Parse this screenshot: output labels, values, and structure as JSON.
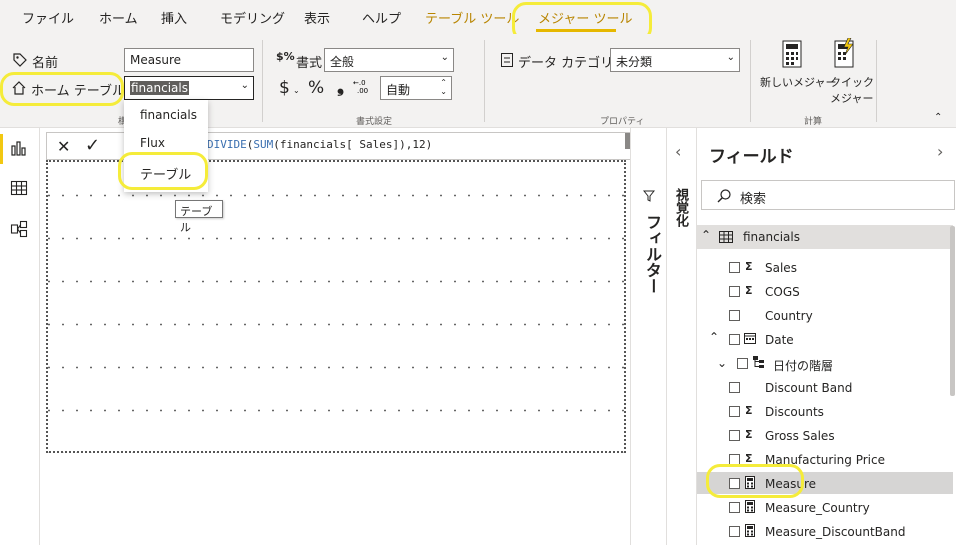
{
  "menu": {
    "tabs": [
      {
        "label": "ファイル"
      },
      {
        "label": "ホーム"
      },
      {
        "label": "挿入"
      },
      {
        "label": "モデリング"
      },
      {
        "label": "表示"
      },
      {
        "label": "ヘルプ"
      },
      {
        "label": "テーブル ツール"
      },
      {
        "label": "メジャー ツール"
      }
    ],
    "active_tab": "メジャー ツール"
  },
  "ribbon": {
    "structure": {
      "name_label": "名前",
      "name_value": "Measure",
      "home_table_label": "ホーム テーブル",
      "home_table_value": "financials",
      "group_title": "構"
    },
    "format": {
      "format_label": "書式",
      "format_value": "全般",
      "currency_symbol": "$",
      "percent_symbol": "%",
      "comma_symbol": "❟",
      "decimal_value": "自動",
      "group_title": "書式設定"
    },
    "properties": {
      "data_category_label": "データ カテゴリ",
      "data_category_value": "未分類",
      "group_title": "プロパティ"
    },
    "calculations": {
      "new_measure_label": "新しいメジャー",
      "quick_measure_label_1": "クイック",
      "quick_measure_label_2": "メジャー",
      "group_title": "計算"
    }
  },
  "dropdown": {
    "items": [
      "financials",
      "Flux",
      "テーブル"
    ],
    "tooltip": "テーブル"
  },
  "formula": {
    "fn1": "DIVIDE",
    "open1": "(",
    "fn2": "SUM",
    "rest": "(financials[ Sales]),12)"
  },
  "filters": {
    "label": "フィルター"
  },
  "visualizations": {
    "label": "視覚化"
  },
  "fields": {
    "title": "フィールド",
    "search_placeholder": "検索",
    "table_name": "financials",
    "items": [
      {
        "name": "Sales",
        "icon": "sigma"
      },
      {
        "name": "COGS",
        "icon": "sigma"
      },
      {
        "name": "Country",
        "icon": "none"
      },
      {
        "name": "Date",
        "icon": "calendar"
      },
      {
        "name": "日付の階層",
        "icon": "hierarchy"
      },
      {
        "name": "Discount Band",
        "icon": "none"
      },
      {
        "name": "Discounts",
        "icon": "sigma"
      },
      {
        "name": "Gross Sales",
        "icon": "sigma"
      },
      {
        "name": "Manufacturing Price",
        "icon": "sigma"
      },
      {
        "name": "Measure",
        "icon": "calculator"
      },
      {
        "name": "Measure_Country",
        "icon": "calculator"
      },
      {
        "name": "Measure_DiscountBand",
        "icon": "calculator"
      }
    ]
  },
  "colors": {
    "active_tab": "#b88500",
    "highlight": "#f5ec3a",
    "selection": "#605e5c"
  }
}
